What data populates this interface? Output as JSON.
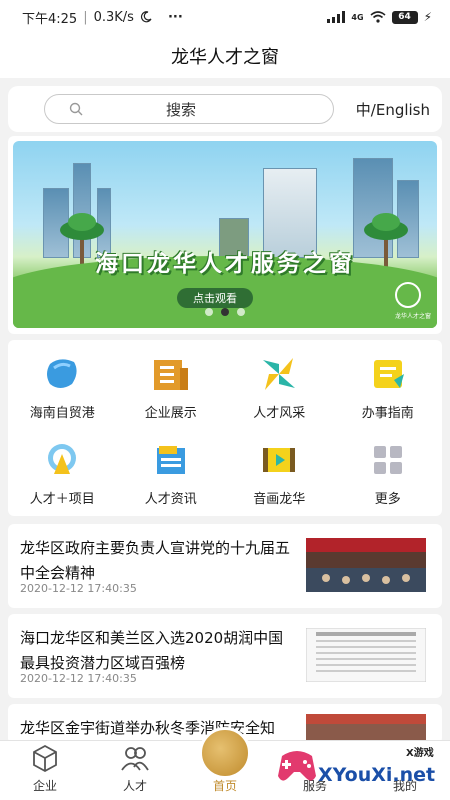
{
  "status_bar": {
    "time": "下午4:25",
    "speed": "0.3K/s",
    "moon_icon": "moon-icon",
    "more": "···",
    "network": "4G",
    "battery": "64"
  },
  "header": {
    "title": "龙华人才之窗"
  },
  "search": {
    "placeholder": "搜索",
    "lang_toggle": "中/English"
  },
  "banner": {
    "title": "海口龙华人才服务之窗",
    "cta": "点击观看",
    "logo_text": "龙华人才之窗",
    "active_slide": 2,
    "slide_count": 3
  },
  "grid": {
    "items": [
      {
        "label": "海南自贸港",
        "icon": "hainan-map-icon"
      },
      {
        "label": "企业展示",
        "icon": "building-icon"
      },
      {
        "label": "人才风采",
        "icon": "pinwheel-icon"
      },
      {
        "label": "办事指南",
        "icon": "guide-note-icon"
      },
      {
        "label": "人才＋项目",
        "icon": "talent-project-icon"
      },
      {
        "label": "人才资讯",
        "icon": "news-icon"
      },
      {
        "label": "音画龙华",
        "icon": "video-icon"
      },
      {
        "label": "更多",
        "icon": "more-grid-icon"
      }
    ]
  },
  "news": [
    {
      "title": "龙华区政府主要负责人宣讲党的十九届五中全会精神",
      "date": "2020-12-12 17:40:35"
    },
    {
      "title": "海口龙华区和美兰区入选2020胡润中国最具投资潜力区域百强榜",
      "date": "2020-12-12 17:40:35"
    },
    {
      "title": "龙华区金宇街道举办秋冬季消防安全知",
      "date": ""
    }
  ],
  "tabbar": {
    "items": [
      {
        "label": "企业",
        "icon": "company-icon"
      },
      {
        "label": "人才",
        "icon": "people-icon"
      },
      {
        "label": "首页",
        "icon": "home-logo-icon"
      },
      {
        "label": "服务",
        "icon": "service-icon"
      },
      {
        "label": "我的",
        "icon": "profile-icon"
      }
    ],
    "active": "首页"
  },
  "watermark": {
    "brand": "XYouXi.net",
    "small": "X游戏"
  },
  "colors": {
    "accent_gold": "#c08b2c",
    "banner_green": "#2f6e34",
    "watermark_blue": "#1b4fa8"
  }
}
